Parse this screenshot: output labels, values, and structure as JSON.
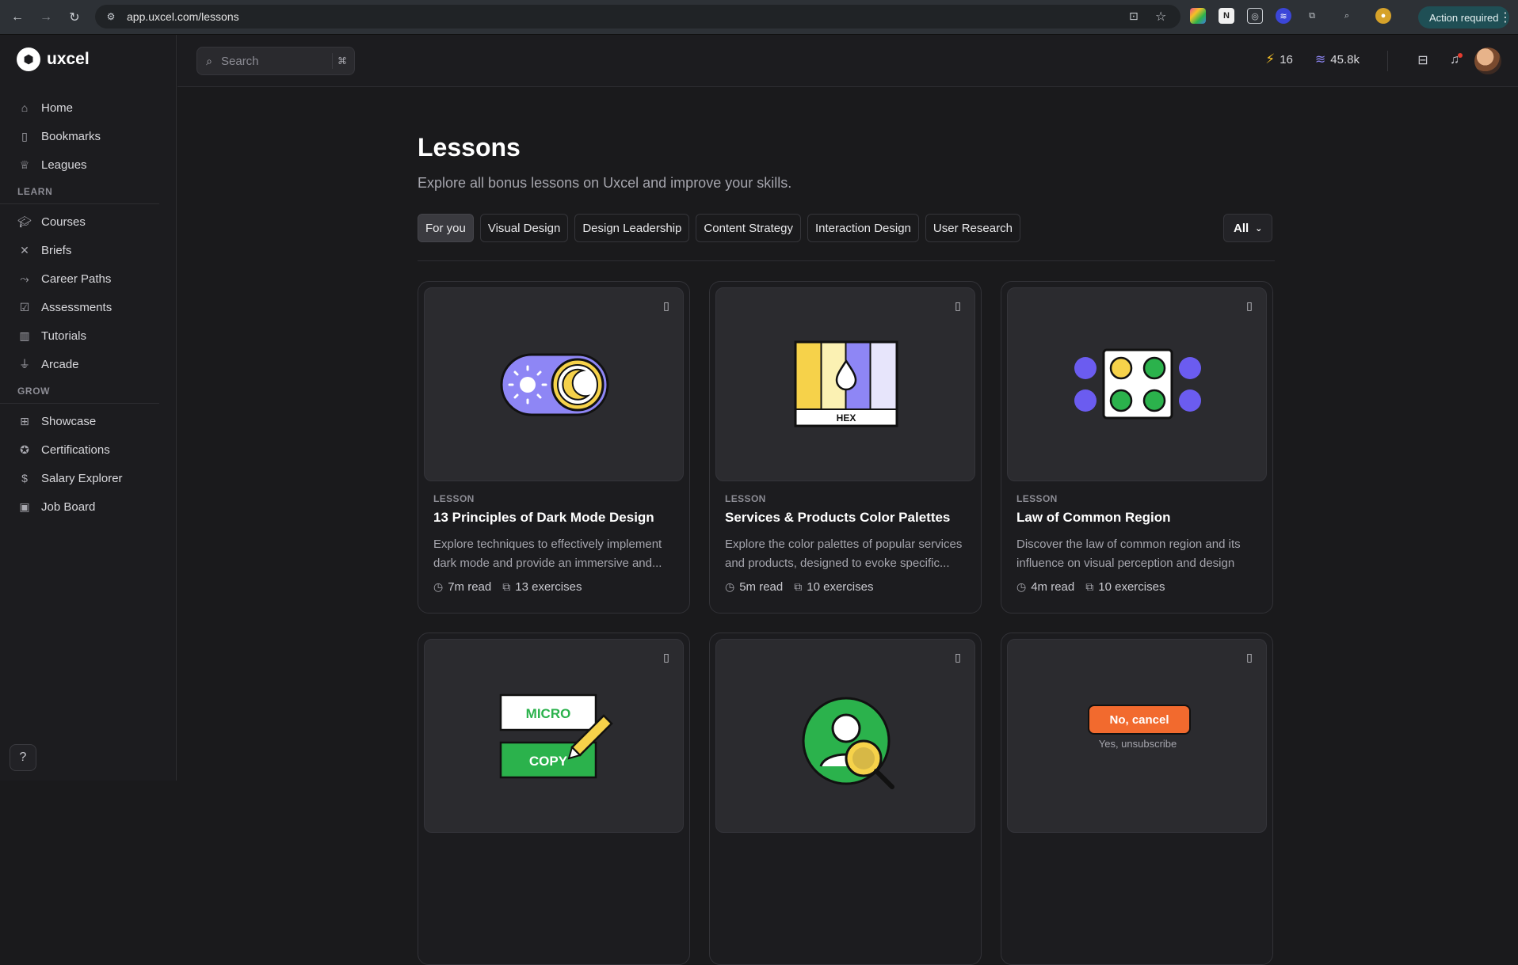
{
  "browser": {
    "url": "app.uxcel.com/lessons",
    "action_required": "Action required"
  },
  "brand": {
    "name": "uxcel"
  },
  "sidebar": {
    "top_items": [
      {
        "label": "Home",
        "icon": "home-icon"
      },
      {
        "label": "Bookmarks",
        "icon": "bookmark-icon"
      },
      {
        "label": "Leagues",
        "icon": "trophy-icon"
      }
    ],
    "sections": [
      {
        "label": "LEARN",
        "items": [
          {
            "label": "Courses",
            "icon": "graduation-cap-icon"
          },
          {
            "label": "Briefs",
            "icon": "tools-icon"
          },
          {
            "label": "Career Paths",
            "icon": "path-icon"
          },
          {
            "label": "Assessments",
            "icon": "checklist-icon"
          },
          {
            "label": "Tutorials",
            "icon": "book-icon"
          },
          {
            "label": "Arcade",
            "icon": "joystick-icon"
          }
        ]
      },
      {
        "label": "GROW",
        "items": [
          {
            "label": "Showcase",
            "icon": "grid-icon"
          },
          {
            "label": "Certifications",
            "icon": "badge-icon"
          },
          {
            "label": "Salary Explorer",
            "icon": "dollar-icon"
          },
          {
            "label": "Job Board",
            "icon": "briefcase-icon"
          }
        ]
      }
    ]
  },
  "topbar": {
    "search_placeholder": "Search",
    "energy": "16",
    "xp": "45.8k"
  },
  "page": {
    "title": "Lessons",
    "subtitle": "Explore all bonus lessons on Uxcel and improve your skills.",
    "filters": [
      "For you",
      "Visual Design",
      "Design Leadership",
      "Content Strategy",
      "Interaction Design",
      "User Research"
    ],
    "active_filter": "For you",
    "dropdown_value": "All"
  },
  "cards": [
    {
      "kicker": "LESSON",
      "title": "13 Principles of Dark Mode Design",
      "desc": "Explore techniques to effectively implement dark mode and provide an immersive and...",
      "read": "7m read",
      "exercises": "13 exercises"
    },
    {
      "kicker": "LESSON",
      "title": "Services & Products Color Palettes",
      "desc": "Explore the color palettes of popular services and products, designed to evoke specific...",
      "read": "5m read",
      "exercises": "10 exercises",
      "thumb_label": "HEX"
    },
    {
      "kicker": "LESSON",
      "title": "Law of Common Region",
      "desc": "Discover the law of common region and its influence on visual perception and design",
      "read": "4m read",
      "exercises": "10 exercises"
    }
  ],
  "row2": {
    "micro": "MICRO",
    "copy": "COPY",
    "cancel_btn": "No, cancel",
    "unsubscribe": "Yes, unsubscribe"
  },
  "colors": {
    "accent_purple": "#8e86f5",
    "accent_yellow": "#f6d24a",
    "accent_green": "#2bb24c",
    "accent_orange": "#f26a2e"
  }
}
